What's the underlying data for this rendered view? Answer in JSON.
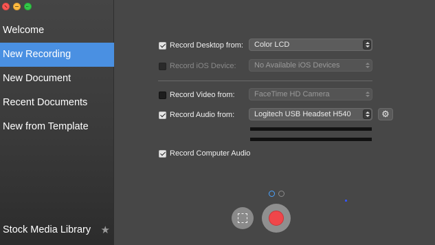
{
  "sidebar": {
    "items": [
      {
        "label": "Welcome"
      },
      {
        "label": "New Recording"
      },
      {
        "label": "New Document"
      },
      {
        "label": "Recent Documents"
      },
      {
        "label": "New from Template"
      }
    ],
    "selected": "New Recording",
    "footer_label": "Stock Media Library"
  },
  "recording": {
    "desktop": {
      "label": "Record Desktop from:",
      "checked": true,
      "value": "Color LCD"
    },
    "ios": {
      "label": "Record iOS Device:",
      "checked": false,
      "enabled": false,
      "value": "No Available iOS Devices"
    },
    "video": {
      "label": "Record Video from:",
      "checked": false,
      "value": "FaceTime HD Camera"
    },
    "audio": {
      "label": "Record Audio from:",
      "checked": true,
      "value": "Logitech USB Headset H540"
    },
    "computer_audio": {
      "label": "Record Computer Audio",
      "checked": true
    }
  },
  "page_indicator": {
    "count": 2,
    "active": 1
  },
  "colors": {
    "sidebar_selected": "#4a90e2",
    "record": "#f0464a",
    "background": "#474747"
  },
  "icons": [
    "star-icon",
    "gear-icon",
    "region-select-icon",
    "record-icon",
    "stepper-icon"
  ]
}
